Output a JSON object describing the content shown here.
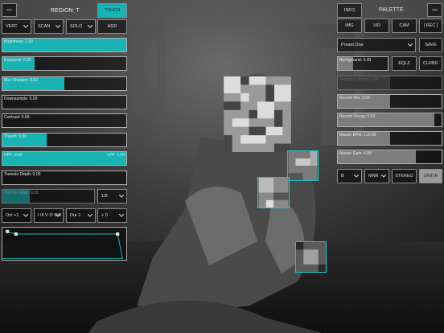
{
  "left_panel": {
    "back_button": "<>",
    "region_label": "REGION: T",
    "touch_button": "TOUCH",
    "mode_selects": [
      "VERT",
      "SCAN",
      "SOLO"
    ],
    "add_button": "ADD",
    "sliders": [
      {
        "label": "Brightness: 1.00",
        "value": 1.0
      },
      {
        "label": "Exposure: 0.26",
        "value": 0.26
      },
      {
        "label": "Blur-Sharpen: 0.50",
        "value": 0.5
      },
      {
        "label": "Downsample: 0.00",
        "value": 0.0
      },
      {
        "label": "Contrast: 0.00",
        "value": 0.0
      },
      {
        "label": "Thresh: 0.36",
        "value": 0.36
      }
    ],
    "filter_slider": {
      "left_label": "HPF: 0.00",
      "right_label": "LPF: 1.00",
      "value": 1.0
    },
    "tremolo_depth": {
      "label": "Tremolo Depth: 0.00",
      "value": 0.0
    },
    "tremolo_rate": {
      "label": "Tremolo Rate: 0.30",
      "value": 0.3
    },
    "rate_division": "1/8",
    "bottom_selects": [
      "Oct +1",
      "I III V O III/2",
      "Dur 1",
      "+ 0"
    ],
    "envelope_points": [
      [
        0.04,
        0.12
      ],
      [
        0.11,
        0.2
      ],
      [
        0.93,
        0.2
      ],
      [
        0.97,
        0.96
      ],
      [
        0.0,
        0.96
      ]
    ]
  },
  "right_panel": {
    "info_button": "INFO",
    "palette_label": "PALETTE",
    "forward_button": "<>",
    "source_buttons": [
      "IMG",
      "VID",
      "CAM",
      "[ REC ]"
    ],
    "preset_select": "Preset One",
    "save_button": "SAVE",
    "background_slider": {
      "label": "Background: 0.30",
      "value": 0.3
    },
    "eqlz_button": "EQLZ",
    "clrbg_button": "CLRBG",
    "playback_slider": {
      "label": "Playback Speed: 1.00",
      "value": 0.5
    },
    "reverb_mix": {
      "label": "Reverb Mix: 0.50",
      "value": 0.5
    },
    "reverb_decay": {
      "label": "Reverb Decay: 0.93",
      "value": 0.93
    },
    "master_bpm": {
      "label": "Master BPM: 120.00",
      "value": 0.5
    },
    "master_gain": {
      "label": "Master Gain: 4.98",
      "value": 0.75
    },
    "key_select": "B",
    "scale_select": "MNR",
    "stereo_button": "STEREO",
    "limiter_button": "LIMITR"
  },
  "colors": {
    "accent": "#19b3b3",
    "region_box": "#1fc4c4"
  }
}
